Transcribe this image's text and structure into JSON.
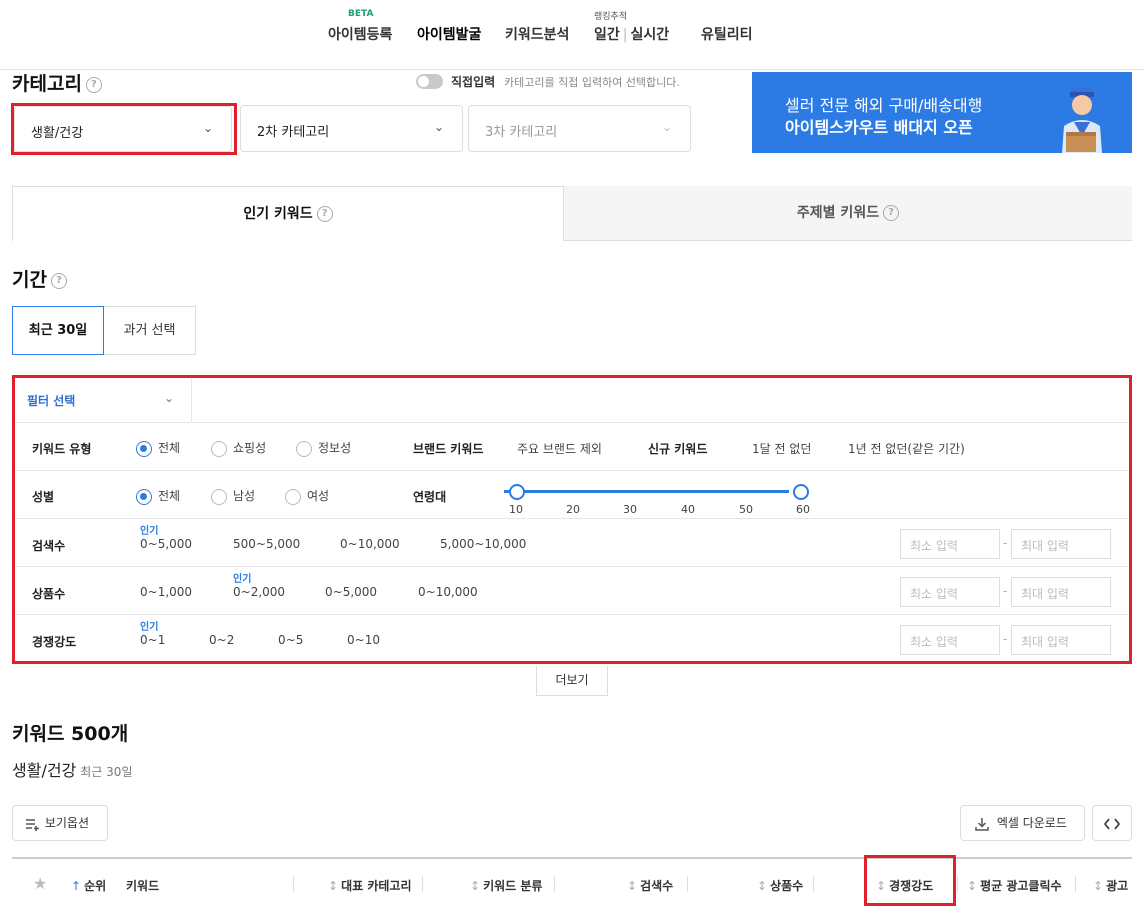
{
  "nav": {
    "items": [
      {
        "label": "아이템등록",
        "sup": "BETA"
      },
      {
        "label": "아이템발굴",
        "active": true
      },
      {
        "label": "키워드분석"
      },
      {
        "label_a": "일간",
        "label_b": "실시간",
        "sup": "랭킹추적"
      },
      {
        "label": "유틸리티"
      }
    ]
  },
  "category": {
    "title": "카테고리",
    "toggle_label": "직접입력",
    "toggle_desc": "카테고리를 직접 입력하여 선택합니다.",
    "select1": "생활/건강",
    "select2": "2차 카테고리",
    "select3": "3차 카테고리"
  },
  "banner": {
    "line1": "셀러 전문 해외 구매/배송대행",
    "line2": "아이템스카우트 배대지 오픈"
  },
  "tabs": {
    "popular": "인기 키워드",
    "topic": "주제별 키워드"
  },
  "period": {
    "title": "기간",
    "recent": "최근 30일",
    "past": "과거 선택"
  },
  "filter": {
    "select_label": "필터 선택",
    "keyword_type": {
      "label": "키워드 유형",
      "options": [
        "전체",
        "쇼핑성",
        "정보성"
      ],
      "selected": "전체"
    },
    "brand": {
      "label": "브랜드 키워드",
      "value": "주요 브랜드 제외"
    },
    "new_kw": {
      "label": "신규 키워드",
      "opt1": "1달 전 없던",
      "opt2": "1년 전 없던(같은 기간)"
    },
    "gender": {
      "label": "성별",
      "options": [
        "전체",
        "남성",
        "여성"
      ],
      "selected": "전체"
    },
    "age": {
      "label": "연령대",
      "ticks": [
        "10",
        "20",
        "30",
        "40",
        "50",
        "60"
      ],
      "range": [
        10,
        60
      ]
    },
    "search": {
      "label": "검색수",
      "options": [
        "0~5,000",
        "500~5,000",
        "0~10,000",
        "5,000~10,000"
      ],
      "popular_tag": "인기"
    },
    "products": {
      "label": "상품수",
      "options": [
        "0~1,000",
        "0~2,000",
        "0~5,000",
        "0~10,000"
      ],
      "popular_tag": "인기"
    },
    "competition": {
      "label": "경쟁강도",
      "options": [
        "0~1",
        "0~2",
        "0~5",
        "0~10"
      ],
      "popular_tag": "인기"
    },
    "min_placeholder": "최소 입력",
    "max_placeholder": "최대 입력",
    "more": "더보기"
  },
  "keywords": {
    "title": "키워드 500개",
    "category": "생활/건강",
    "period": "최근 30일",
    "view_options": "보기옵션",
    "excel": "엑셀 다운로드",
    "columns": [
      "순위",
      "키워드",
      "대표 카테고리",
      "키워드 분류",
      "검색수",
      "상품수",
      "경쟁강도",
      "평균 광고클릭수",
      "광고"
    ]
  }
}
